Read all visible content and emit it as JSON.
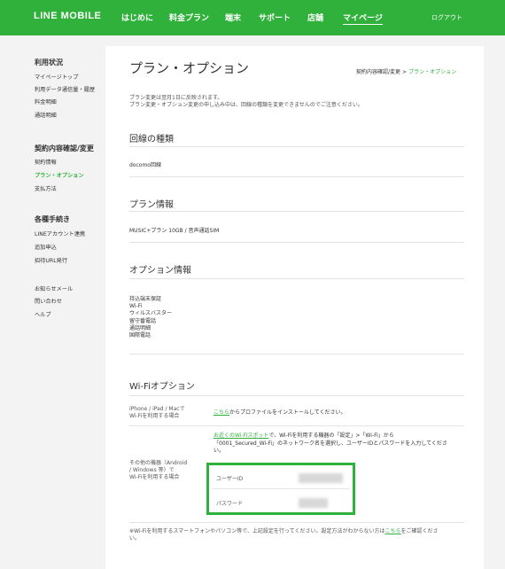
{
  "header": {
    "logo": "LINE MOBILE",
    "nav": [
      "はじめに",
      "料金プラン",
      "端末",
      "サポート",
      "店舗",
      "マイページ"
    ],
    "logout": "ログアウト",
    "brand_color": "#2fb13c"
  },
  "sidebar": {
    "groups": [
      {
        "heading": "利用状況",
        "links": [
          "マイページトップ",
          "利用データ通信量・履歴",
          "料金明細",
          "通話明細"
        ]
      },
      {
        "heading": "契約内容確認/変更",
        "links": [
          "契約情報",
          "プラン・オプション",
          "支払方法"
        ]
      },
      {
        "heading": "各種手続き",
        "links": [
          "LINEアカウント連携",
          "追加申込",
          "招待URL発行"
        ]
      },
      {
        "heading": "",
        "links": [
          "お知らせメール",
          "問い合わせ",
          "ヘルプ"
        ]
      }
    ],
    "active": "プラン・オプション"
  },
  "main": {
    "title": "プラン・オプション",
    "breadcrumb": {
      "parent": "契約内容確認/変更",
      "separator": ">",
      "current": "プラン・オプション"
    },
    "notice": [
      "プラン変更は翌月1日に反映されます。",
      "プラン変更・オプション変更の申し込み中は、回線の種類を変更できませんのでご注意ください。"
    ],
    "line_type": {
      "title": "回線の種類",
      "value": "docomo回線"
    },
    "plan": {
      "title": "プラン情報",
      "value": "MUSIC+プラン 10GB / 音声通話SIM"
    },
    "options": {
      "title": "オプション情報",
      "items": [
        "持込端末保証",
        "Wi-Fi",
        "ウィルスバスター",
        "留守番電話",
        "通話明細",
        "国際電話"
      ]
    },
    "wifi": {
      "title": "Wi-Fiオプション",
      "apple_label": [
        "iPhone / iPad / Macで",
        "Wi-Fiを利用する場合"
      ],
      "apple_link": "こちら",
      "apple_text": "からプロファイルをインストールしてください。",
      "other_label": [
        "その他の機器（Android",
        "/ Windows 等）で",
        "Wi-Fiを利用する場合"
      ],
      "spot_link": "お近くのWi-Fiスポット",
      "other_text1": "で、Wi-Fiを利用する機器の「設定」>「Wi-Fi」から",
      "other_text2": "「0001_Secured_Wi-Fi」のネットワーク名を選択し、ユーザーIDとパスワードを入力してくださ",
      "other_text3": "い。",
      "user_id_label": "ユーザーID",
      "password_label": "パスワード",
      "footnote_before": "※Wi-Fiを利用するスマートフォンやパソコン等で、上記設定を行ってください。設定方法がわからない方は",
      "footnote_link": "こちら",
      "footnote_after": "をご確認くださ",
      "footnote_line2": "い。"
    }
  }
}
